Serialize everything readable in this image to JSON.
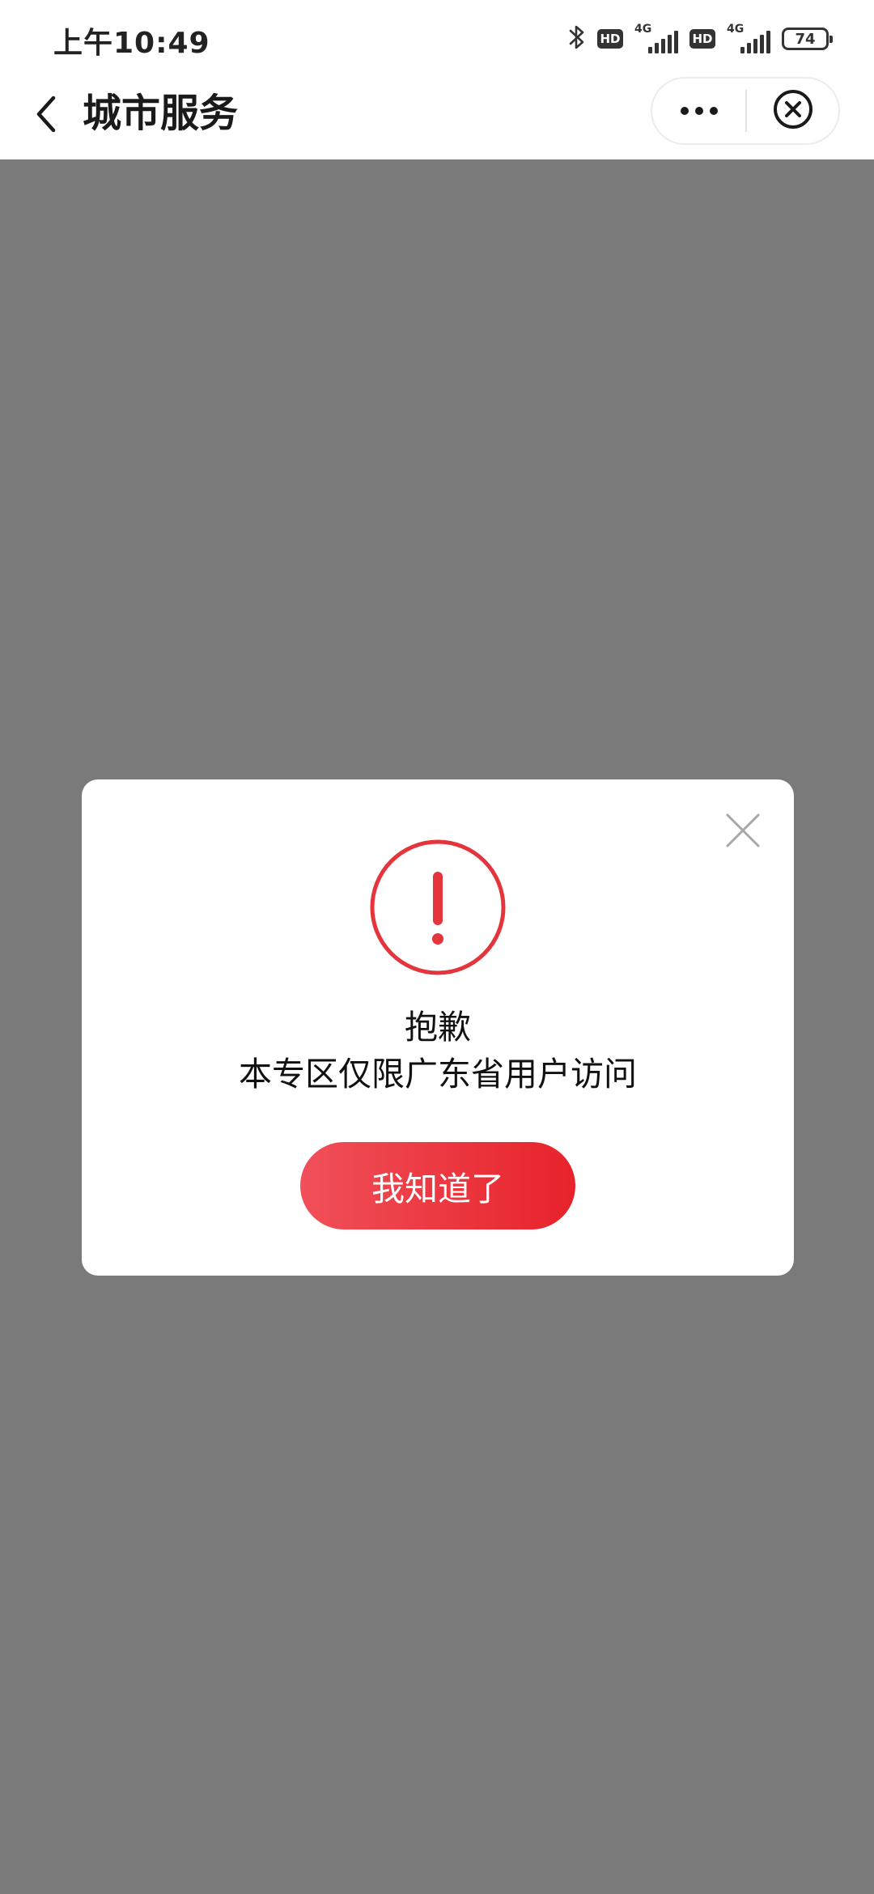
{
  "status_bar": {
    "time": "上午10:49",
    "hd_label": "HD",
    "network_label": "4G",
    "battery_level": "74",
    "icons": [
      "bluetooth-icon",
      "hd-icon",
      "signal-4g-icon",
      "hd-icon",
      "signal-4g-icon",
      "battery-icon"
    ]
  },
  "nav": {
    "title": "城市服务",
    "icons": [
      "back-arrow-icon",
      "more-dots-icon",
      "close-circle-icon"
    ]
  },
  "dialog": {
    "icon": "exclamation-circle-icon",
    "title": "抱歉",
    "message": "本专区仅限广东省用户访问",
    "button_label": "我知道了",
    "close_icon": "close-x-icon"
  },
  "colors": {
    "overlay": "#7a7a7a",
    "accent_red": "#e3353b",
    "button_start": "#f0505a",
    "button_end": "#e8222a"
  }
}
